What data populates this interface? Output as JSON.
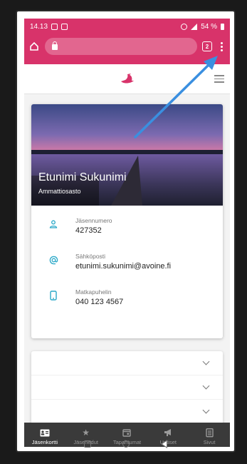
{
  "status_bar": {
    "time": "14.13",
    "battery": "54 %"
  },
  "browser": {
    "tabs_count": "2"
  },
  "member_card": {
    "name": "Etunimi Sukunimi",
    "section": "Ammattiosasto",
    "fields": [
      {
        "label": "Jäsennumero",
        "value": "427352",
        "icon": "person-icon"
      },
      {
        "label": "Sähköposti",
        "value": "etunimi.sukunimi@avoine.fi",
        "icon": "at-icon"
      },
      {
        "label": "Matkapuhelin",
        "value": "040 123 4567",
        "icon": "phone-icon"
      }
    ]
  },
  "bottom_nav": [
    {
      "label": "Jäsenkortti",
      "icon": "id-card-icon",
      "active": true
    },
    {
      "label": "Jäsenedut",
      "icon": "star-icon",
      "active": false
    },
    {
      "label": "Tapahtumat",
      "icon": "calendar-icon",
      "active": false
    },
    {
      "label": "Uutiset",
      "icon": "megaphone-icon",
      "active": false
    },
    {
      "label": "Sivut",
      "icon": "pages-icon",
      "active": false
    }
  ],
  "colors": {
    "brand": "#d8336a",
    "accent": "#2aa8c8",
    "nav_bg": "#3a3a3a",
    "arrow": "#3a8fe0"
  }
}
